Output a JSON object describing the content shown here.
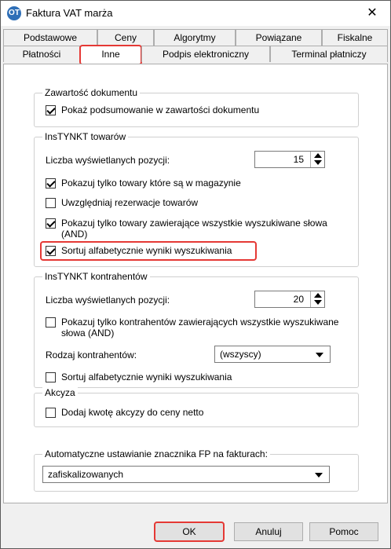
{
  "window": {
    "title": "Faktura VAT marża",
    "close_glyph": "✕"
  },
  "tabs_row1": [
    "Podstawowe",
    "Ceny",
    "Algorytmy",
    "Powiązane",
    "Fiskalne"
  ],
  "tabs_row2": [
    "Płatności",
    "Inne",
    "Podpis elektroniczny",
    "Terminal płatniczy"
  ],
  "groups": {
    "zawartosc": {
      "legend": "Zawartość dokumentu",
      "summary_label": "Pokaż podsumowanie w zawartości dokumentu",
      "summary_checked": true
    },
    "instynkt_towary": {
      "legend": "InsTYNKT towarów",
      "count_label": "Liczba wyświetlanych pozycji:",
      "count_value": "15",
      "only_in_stock": "Pokazuj tylko towary które są w magazynie",
      "reservations": "Uwzględniaj rezerwacje towarów",
      "all_words": "Pokazuj tylko towary zawierające wszystkie wyszukiwane słowa (AND)",
      "sort_alpha": "Sortuj alfabetycznie wyniki wyszukiwania"
    },
    "instynkt_kontrahenci": {
      "legend": "InsTYNKT kontrahentów",
      "count_label": "Liczba wyświetlanych pozycji:",
      "count_value": "20",
      "all_words": "Pokazuj tylko kontrahentów zawierających wszystkie wyszukiwane słowa (AND)",
      "type_label": "Rodzaj kontrahentów:",
      "type_value": "(wszyscy)",
      "sort_alpha": "Sortuj alfabetycznie wyniki wyszukiwania"
    },
    "akcyza": {
      "legend": "Akcyza",
      "add_excise": "Dodaj kwotę akcyzy do ceny netto"
    },
    "fp": {
      "legend": "Automatyczne ustawianie znacznika FP na fakturach:",
      "value": "zafiskalizowanych"
    }
  },
  "buttons": {
    "ok": "OK",
    "cancel": "Anuluj",
    "help": "Pomoc"
  },
  "colors": {
    "highlight": "#e53935"
  }
}
